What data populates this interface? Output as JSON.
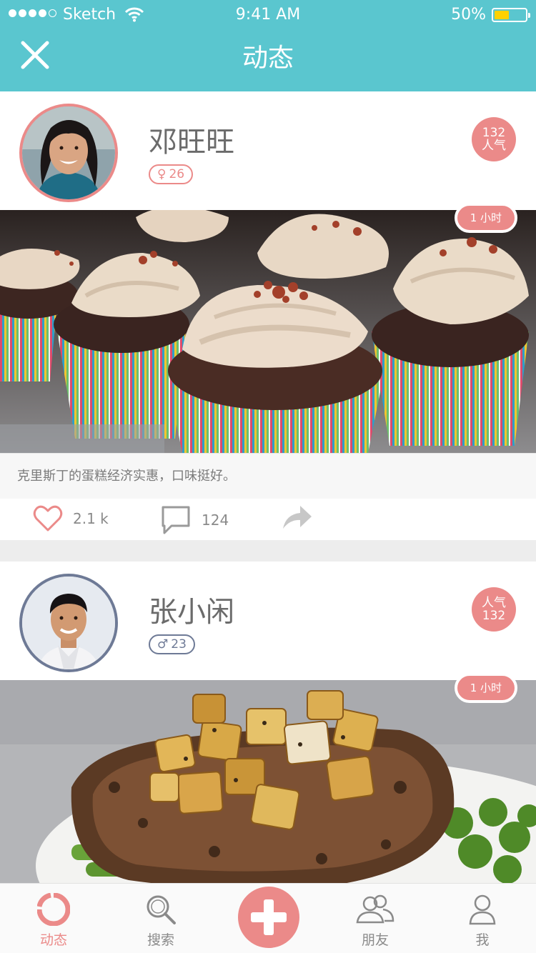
{
  "status_bar": {
    "carrier": "Sketch",
    "time": "9:41 AM",
    "battery": "50%"
  },
  "header": {
    "title": "动态"
  },
  "posts": [
    {
      "username": "邓旺旺",
      "gender_symbol": "♀",
      "age": "26",
      "popularity_value": "132",
      "popularity_label": "人气",
      "time_ago": "1 小时",
      "caption": "克里斯丁的蛋糕经济实惠，口味挺好。",
      "likes": "2.1 k",
      "comments": "124"
    },
    {
      "username": "张小闲",
      "gender_symbol": "♂",
      "age": "23",
      "popularity_value": "132",
      "popularity_label": "人气",
      "time_ago": "1 小时"
    }
  ],
  "tabbar": {
    "items": [
      {
        "label": "动态"
      },
      {
        "label": "搜索"
      },
      {
        "label": "朋友"
      },
      {
        "label": "我"
      }
    ]
  },
  "colors": {
    "header_teal": "#5ac6cf",
    "accent_pink": "#eb8a89",
    "male_slate": "#6e7a96"
  }
}
